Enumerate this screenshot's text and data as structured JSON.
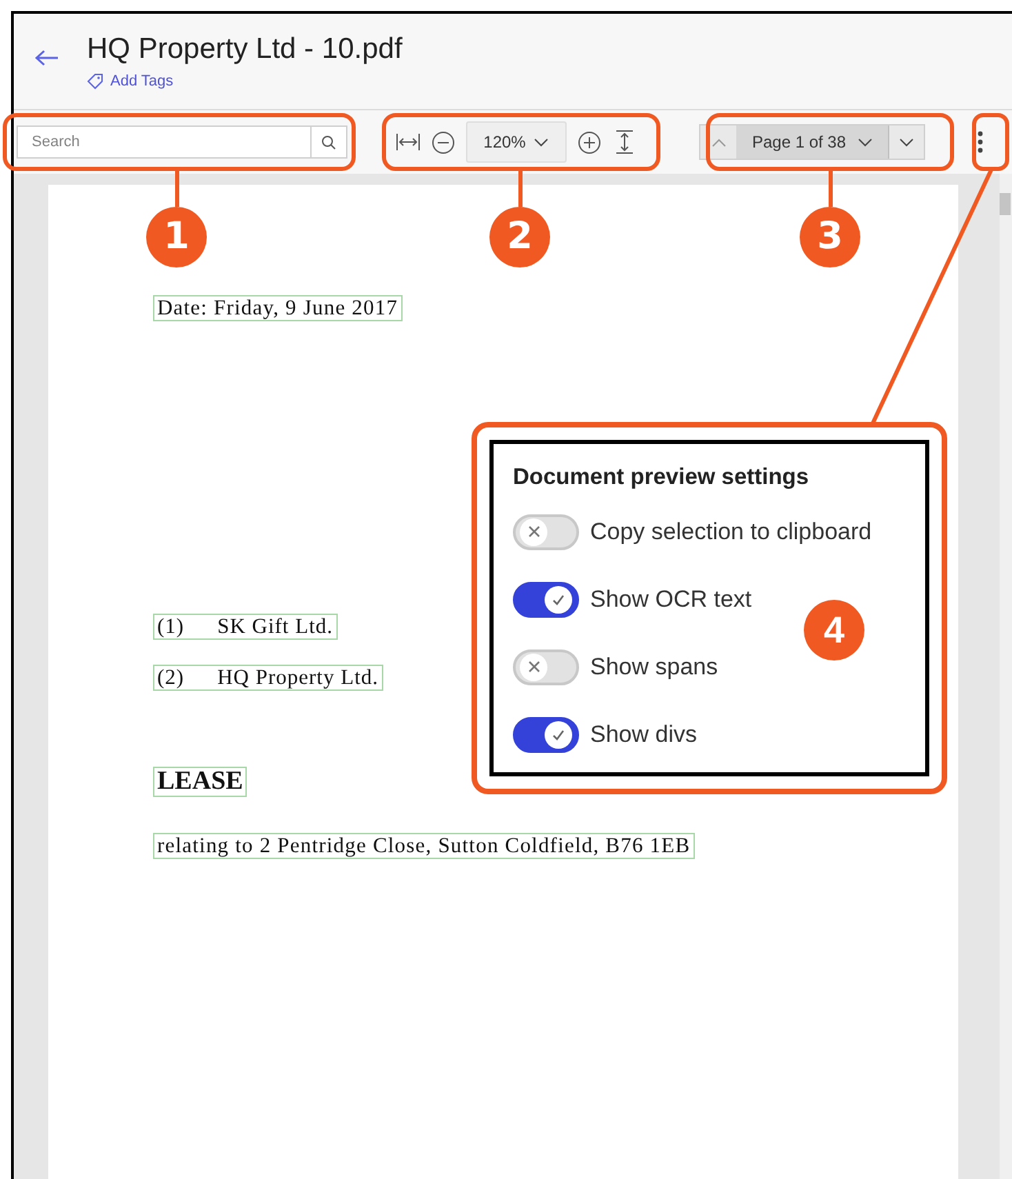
{
  "header": {
    "title": "HQ Property Ltd - 10.pdf",
    "add_tags": "Add Tags"
  },
  "toolbar": {
    "search": {
      "placeholder": "Search"
    },
    "zoom": "120%",
    "page": "Page 1 of 38"
  },
  "document": {
    "lines": [
      {
        "kind": "date",
        "text": "Date: Friday, 9 June 2017"
      },
      {
        "kind": "party",
        "number": "(1)",
        "text": "SK Gift Ltd."
      },
      {
        "kind": "party",
        "number": "(2)",
        "text": "HQ Property Ltd."
      },
      {
        "kind": "heading",
        "text": "LEASE"
      },
      {
        "kind": "paragraph",
        "text": "relating to 2 Pentridge Close, Sutton Coldfield, B76 1EB"
      }
    ]
  },
  "settings_popup": {
    "title": "Document preview settings",
    "options": [
      {
        "label": "Copy selection to clipboard",
        "on": false
      },
      {
        "label": "Show OCR text",
        "on": true
      },
      {
        "label": "Show spans",
        "on": false
      },
      {
        "label": "Show divs",
        "on": true
      }
    ]
  },
  "callouts": [
    "1",
    "2",
    "3",
    "4"
  ]
}
